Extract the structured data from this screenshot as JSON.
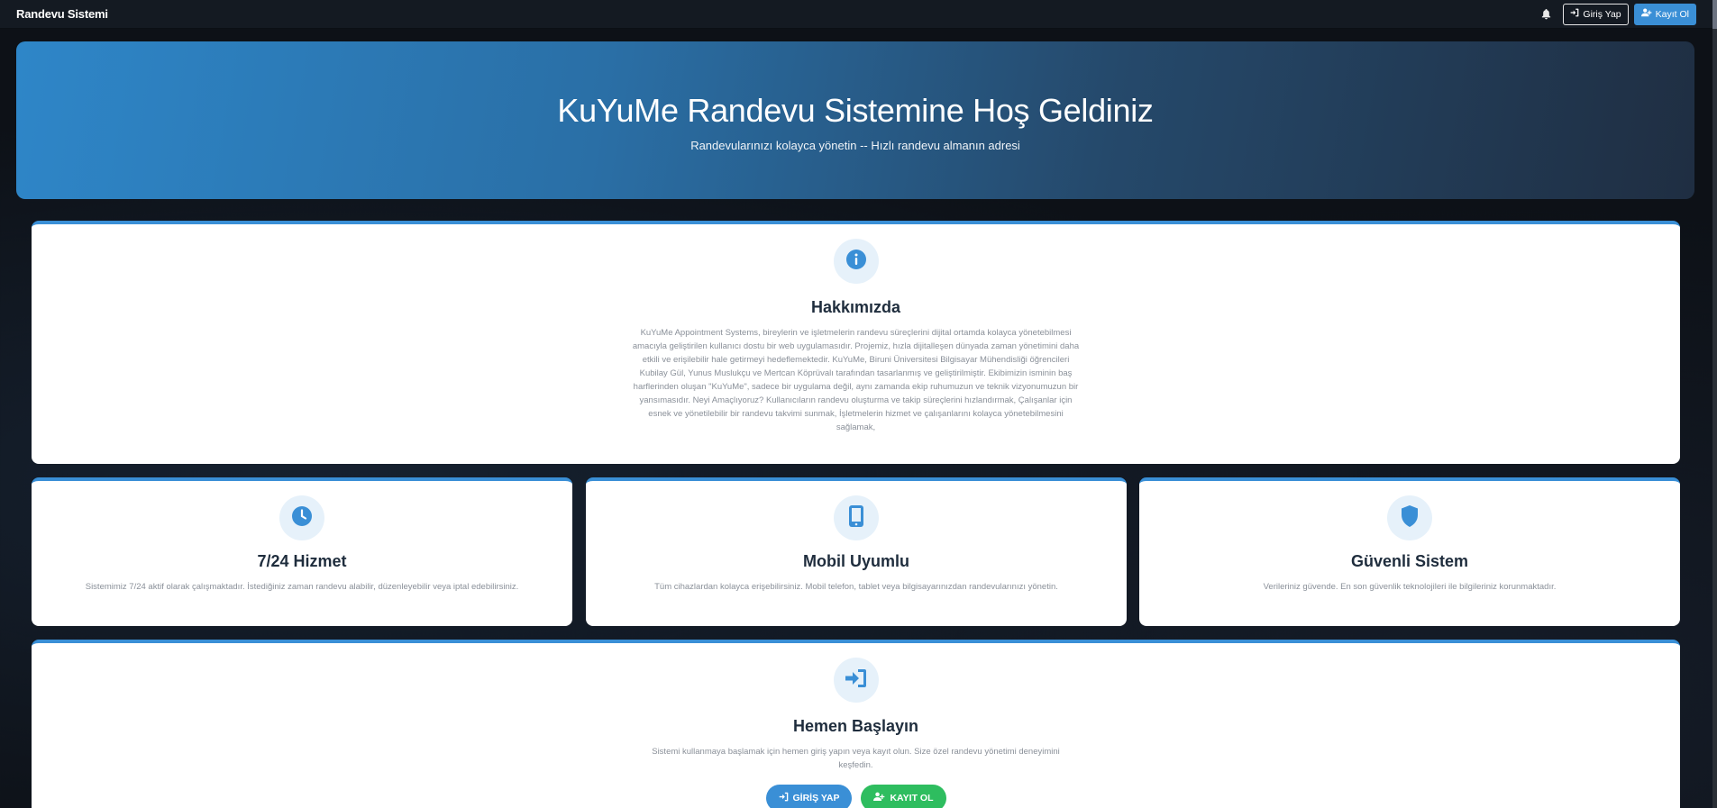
{
  "navbar": {
    "brand": "Randevu Sistemi",
    "login_label": "Giriş Yap",
    "register_label": "Kayıt Ol"
  },
  "hero": {
    "title": "KuYuMe Randevu Sistemine Hoş Geldiniz",
    "subtitle": "Randevularınızı kolayca yönetin -- Hızlı randevu almanın adresi"
  },
  "about": {
    "title": "Hakkımızda",
    "text": "KuYuMe Appointment Systems, bireylerin ve işletmelerin randevu süreçlerini dijital ortamda kolayca yönetebilmesi amacıyla geliştirilen kullanıcı dostu bir web uygulamasıdır. Projemiz, hızla dijitalleşen dünyada zaman yönetimini daha etkili ve erişilebilir hale getirmeyi hedeflemektedir. KuYuMe, Biruni Üniversitesi Bilgisayar Mühendisliği öğrencileri Kubilay Gül, Yunus Muslukçu ve Mertcan Köprüvalı tarafından tasarlanmış ve geliştirilmiştir. Ekibimizin isminin baş harflerinden oluşan \"KuYuMe\", sadece bir uygulama değil, aynı zamanda ekip ruhumuzun ve teknik vizyonumuzun bir yansımasıdır. Neyi Amaçlıyoruz? Kullanıcıların randevu oluşturma ve takip süreçlerini hızlandırmak, Çalışanlar için esnek ve yönetilebilir bir randevu takvimi sunmak, İşletmelerin hizmet ve çalışanlarını kolayca yönetebilmesini sağlamak,"
  },
  "features": [
    {
      "title": "7/24 Hizmet",
      "text": "Sistemimiz 7/24 aktif olarak çalışmaktadır. İstediğiniz zaman randevu alabilir, düzenleyebilir veya iptal edebilirsiniz."
    },
    {
      "title": "Mobil Uyumlu",
      "text": "Tüm cihazlardan kolayca erişebilirsiniz. Mobil telefon, tablet veya bilgisayarınızdan randevularınızı yönetin."
    },
    {
      "title": "Güvenli Sistem",
      "text": "Verileriniz güvende. En son güvenlik teknolojileri ile bilgileriniz korunmaktadır."
    }
  ],
  "start": {
    "title": "Hemen Başlayın",
    "text": "Sistemi kullanmaya başlamak için hemen giriş yapın veya kayıt olun. Size özel randevu yönetimi deneyimini keşfedin.",
    "login_label": "GİRİŞ YAP",
    "register_label": "KAYIT OL"
  },
  "colors": {
    "accent": "#3a8fd6",
    "success": "#2ebd5f",
    "navbar_bg": "#141a22",
    "page_bg": "#0d1117"
  },
  "icons": {
    "nav_bell": "bell-icon",
    "nav_login": "sign-in-icon",
    "nav_register": "user-plus-icon",
    "about": "info-icon",
    "feature_1": "clock-icon",
    "feature_2": "mobile-icon",
    "feature_3": "shield-icon",
    "start": "sign-in-icon"
  }
}
